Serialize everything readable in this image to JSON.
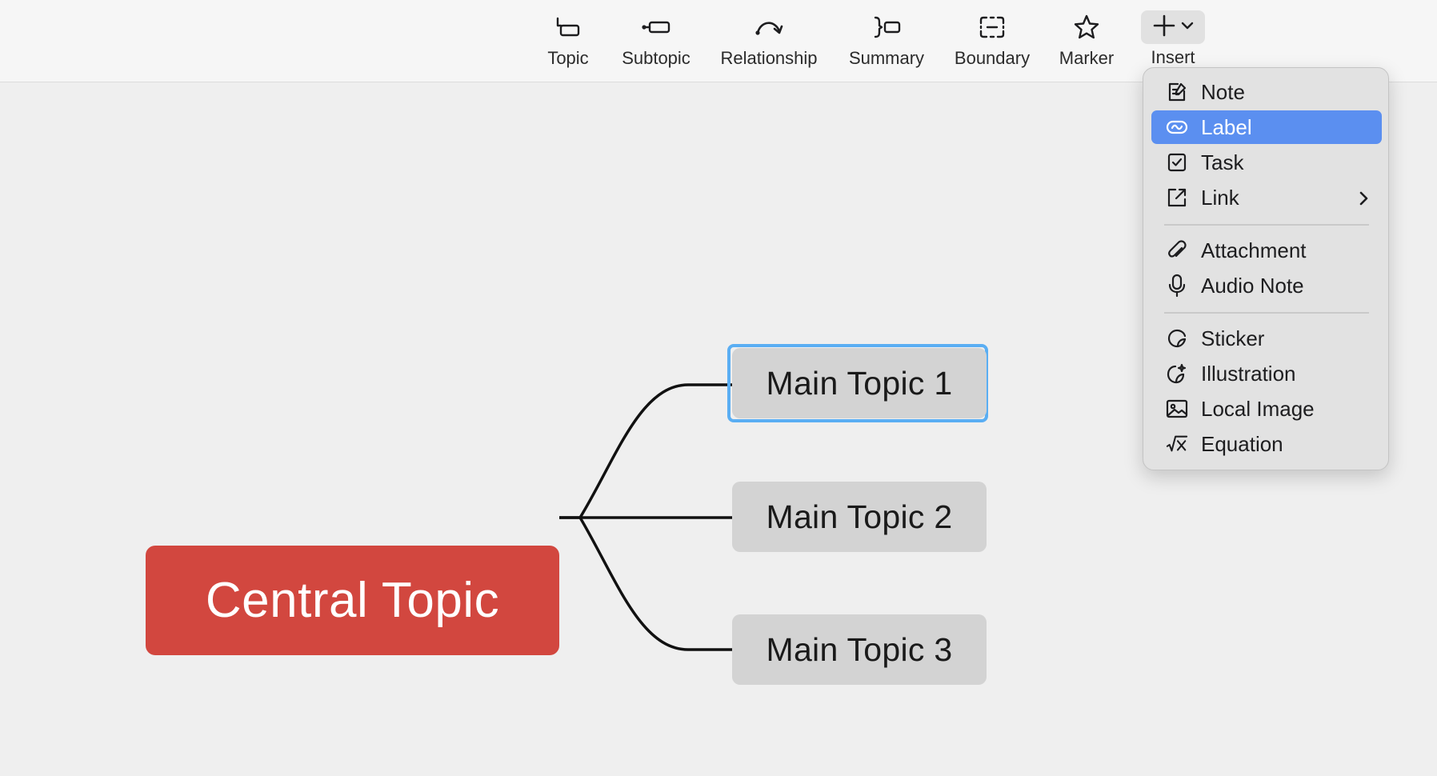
{
  "toolbar": {
    "tools": {
      "topic": {
        "label": "Topic",
        "icon": "topic-icon"
      },
      "subtopic": {
        "label": "Subtopic",
        "icon": "subtopic-icon"
      },
      "relationship": {
        "label": "Relationship",
        "icon": "relationship-icon"
      },
      "summary": {
        "label": "Summary",
        "icon": "summary-icon"
      },
      "boundary": {
        "label": "Boundary",
        "icon": "boundary-icon"
      },
      "marker": {
        "label": "Marker",
        "icon": "star-icon"
      },
      "insert": {
        "label": "Insert",
        "icon": "plus-icon"
      }
    }
  },
  "mindmap": {
    "central_topic": "Central Topic",
    "main_topics": [
      "Main Topic 1",
      "Main Topic 2",
      "Main Topic 3"
    ],
    "selected_topic": "Main Topic 1",
    "colors": {
      "central_fill": "#d2473f",
      "topic_fill": "#d3d3d3",
      "selection": "#5aaef3",
      "connector": "#111111"
    }
  },
  "insert_menu": {
    "highlighted": "Label",
    "highlight_color": "#5b8ff0",
    "items": {
      "note": {
        "label": "Note",
        "icon": "note-icon"
      },
      "label": {
        "label": "Label",
        "icon": "label-icon"
      },
      "task": {
        "label": "Task",
        "icon": "checkbox-icon"
      },
      "link": {
        "label": "Link",
        "icon": "external-link-icon",
        "has_submenu": true
      },
      "attachment": {
        "label": "Attachment",
        "icon": "paperclip-icon"
      },
      "audio_note": {
        "label": "Audio Note",
        "icon": "microphone-icon"
      },
      "sticker": {
        "label": "Sticker",
        "icon": "sticker-icon"
      },
      "illustration": {
        "label": "Illustration",
        "icon": "illustration-icon"
      },
      "local_image": {
        "label": "Local Image",
        "icon": "image-icon"
      },
      "equation": {
        "label": "Equation",
        "icon": "equation-icon"
      }
    }
  }
}
